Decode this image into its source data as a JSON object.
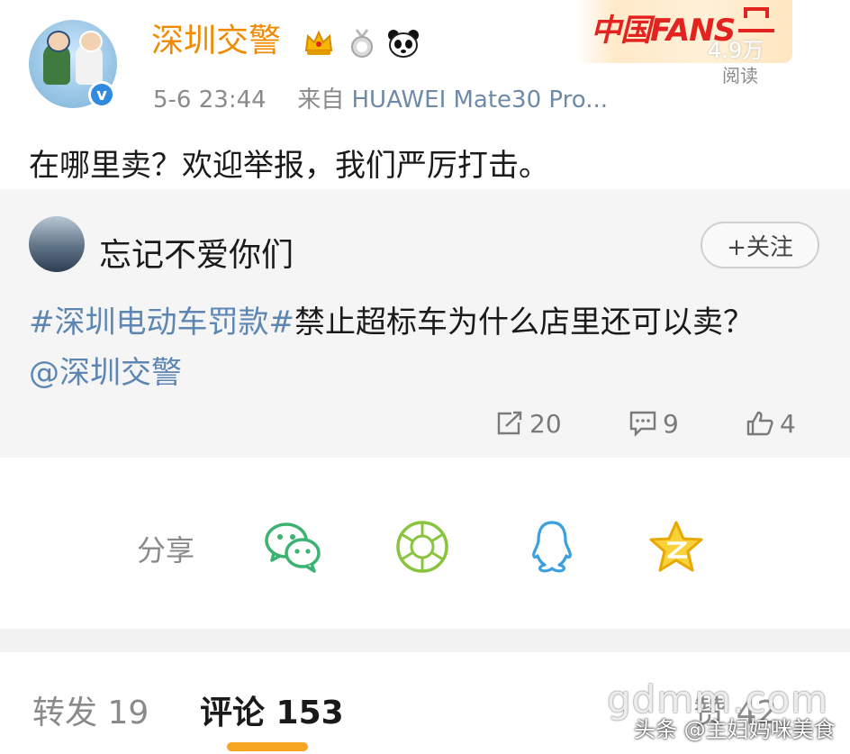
{
  "header": {
    "author_name": "深圳交警",
    "timestamp": "5-6 23:44",
    "source_prefix": "来自",
    "source_device": "HUAWEI Mate30 Pro...",
    "verified_mark": "v",
    "badges": [
      "crown-icon",
      "medal-icon",
      "panda-icon"
    ]
  },
  "fans_banner": {
    "label": "中国FANS",
    "read_count": "4.9万",
    "read_label": "阅读"
  },
  "post": {
    "text": "在哪里卖？欢迎举报，我们严厉打击。"
  },
  "quoted_post": {
    "user_name": "忘记不爱你们",
    "follow_label": "+关注",
    "hashtag": "#深圳电动车罚款#",
    "text_rest": "禁止超标车为什么店里还可以卖？",
    "mention": "@深圳交警",
    "reposts": "20",
    "comments": "9",
    "likes": "4"
  },
  "share": {
    "label": "分享",
    "targets": [
      "wechat-icon",
      "moments-icon",
      "qq-icon",
      "qzone-icon"
    ]
  },
  "tabs": {
    "repost": "转发 19",
    "comment": "评论 153",
    "like": "赞 42"
  },
  "watermark": {
    "site": "gdmm.com",
    "author": "头条 @主妇妈咪美食"
  },
  "colors": {
    "author_orange": "#f08a00",
    "link_blue": "#5d86b3",
    "tab_accent": "#f6a623",
    "verified_blue": "#2f8ae0"
  }
}
